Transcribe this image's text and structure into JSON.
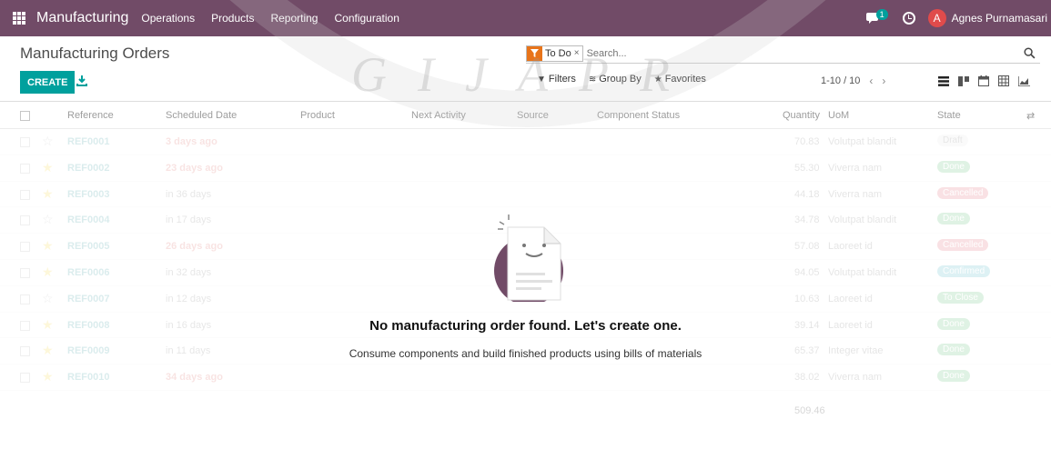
{
  "navbar": {
    "brand": "Manufacturing",
    "menu": [
      "Operations",
      "Products",
      "Reporting",
      "Configuration"
    ],
    "chat_count": "1",
    "avatar_letter": "A",
    "user_name": "Agnes Purnamasari"
  },
  "control_panel": {
    "title": "Manufacturing Orders",
    "create_label": "CREATE",
    "facet_label": "To Do",
    "facet_remove": "×",
    "search_placeholder": "Search...",
    "filters_label": "Filters",
    "groupby_label": "Group By",
    "favorites_label": "Favorites",
    "pager": "1-10 / 10"
  },
  "columns": {
    "reference": "Reference",
    "scheduled_date": "Scheduled Date",
    "product": "Product",
    "next_activity": "Next Activity",
    "source": "Source",
    "component_status": "Component Status",
    "quantity": "Quantity",
    "uom": "UoM",
    "state": "State"
  },
  "rows": [
    {
      "ref": "REF0001",
      "date": "3 days ago",
      "date_kind": "late",
      "starred": false,
      "qty": "70.83",
      "uom": "Volutpat blandit",
      "state": "Draft",
      "state_color": "#e2e2e2"
    },
    {
      "ref": "REF0002",
      "date": "23 days ago",
      "date_kind": "late",
      "starred": true,
      "qty": "55.30",
      "uom": "Viverra nam",
      "state": "Done",
      "state_color": "#28a745"
    },
    {
      "ref": "REF0003",
      "date": "in 36 days",
      "date_kind": "future",
      "starred": true,
      "qty": "44.18",
      "uom": "Viverra nam",
      "state": "Cancelled",
      "state_color": "#dc3545"
    },
    {
      "ref": "REF0004",
      "date": "in 17 days",
      "date_kind": "future",
      "starred": false,
      "qty": "34.78",
      "uom": "Volutpat blandit",
      "state": "Done",
      "state_color": "#28a745"
    },
    {
      "ref": "REF0005",
      "date": "26 days ago",
      "date_kind": "late",
      "starred": true,
      "qty": "57.08",
      "uom": "Laoreet id",
      "state": "Cancelled",
      "state_color": "#dc3545"
    },
    {
      "ref": "REF0006",
      "date": "in 32 days",
      "date_kind": "future",
      "starred": true,
      "qty": "94.05",
      "uom": "Volutpat blandit",
      "state": "Confirmed",
      "state_color": "#17a2b8"
    },
    {
      "ref": "REF0007",
      "date": "in 12 days",
      "date_kind": "future",
      "starred": false,
      "qty": "10.63",
      "uom": "Laoreet id",
      "state": "To Close",
      "state_color": "#28a745"
    },
    {
      "ref": "REF0008",
      "date": "in 16 days",
      "date_kind": "future",
      "starred": true,
      "qty": "39.14",
      "uom": "Laoreet id",
      "state": "Done",
      "state_color": "#28a745"
    },
    {
      "ref": "REF0009",
      "date": "in 11 days",
      "date_kind": "future",
      "starred": true,
      "qty": "65.37",
      "uom": "Integer vitae",
      "state": "Done",
      "state_color": "#28a745"
    },
    {
      "ref": "REF0010",
      "date": "34 days ago",
      "date_kind": "late",
      "starred": true,
      "qty": "38.02",
      "uom": "Viverra nam",
      "state": "Done",
      "state_color": "#28a745"
    }
  ],
  "total_quantity": "509.46",
  "empty_helper": {
    "title": "No manufacturing order found. Let's create one.",
    "subtitle": "Consume components and build finished products using bills of materials"
  },
  "watermark_text": "GIJAPR"
}
